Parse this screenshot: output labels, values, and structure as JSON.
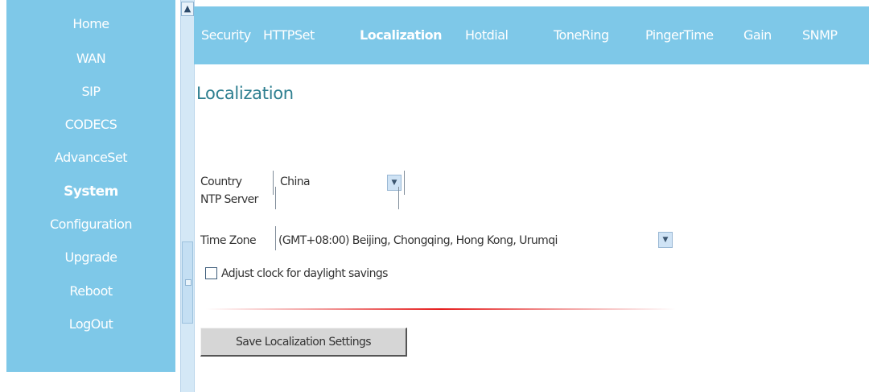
{
  "sidebar": {
    "items": [
      {
        "label": "Home"
      },
      {
        "label": "WAN"
      },
      {
        "label": "SIP"
      },
      {
        "label": "CODECS"
      },
      {
        "label": "AdvanceSet"
      },
      {
        "label": "System"
      },
      {
        "label": "Configuration"
      },
      {
        "label": "Upgrade"
      },
      {
        "label": "Reboot"
      },
      {
        "label": "LogOut"
      }
    ],
    "active": "System"
  },
  "topnav": {
    "tabs": [
      {
        "label": "Security"
      },
      {
        "label": "HTTPSet"
      },
      {
        "label": "Localization"
      },
      {
        "label": "Hotdial"
      },
      {
        "label": "ToneRing"
      },
      {
        "label": "PingerTime"
      },
      {
        "label": "Gain"
      },
      {
        "label": "SNMP"
      }
    ],
    "active": "Localization"
  },
  "main": {
    "title": "Localization",
    "country": {
      "label": "Country",
      "value": "China"
    },
    "ntp_server": {
      "label": "NTP Server",
      "value": ""
    },
    "time_zone": {
      "label": "Time Zone",
      "value": "(GMT+08:00) Beijing, Chongqing, Hong Kong, Urumqi"
    },
    "dst": {
      "label": "Adjust clock for daylight savings",
      "checked": false
    },
    "save_label": "Save Localization Settings"
  },
  "colors": {
    "sidebar_bg": "#7ec8e8",
    "title_color": "#2e7f90",
    "divider_accent": "#e51e1e"
  },
  "icons": {
    "scroll_up": "triangle-up-icon",
    "dropdown": "chevron-down-icon"
  }
}
